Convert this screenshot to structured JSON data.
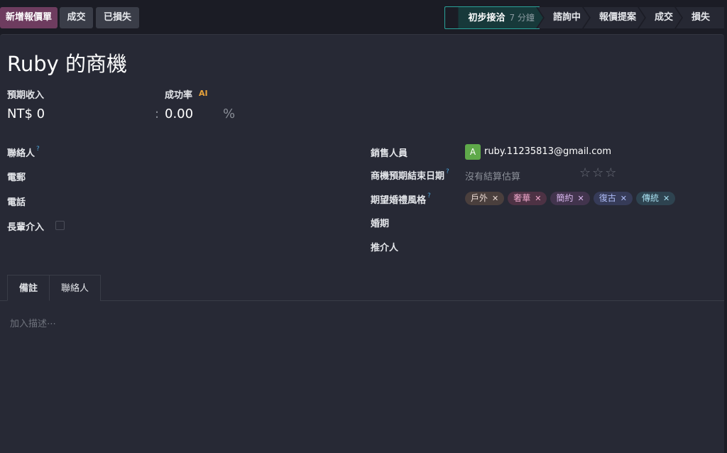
{
  "toolbar": {
    "new_quote": "新增報價單",
    "won": "成交",
    "lost": "已損失"
  },
  "stages": [
    {
      "label": "初步接洽",
      "duration": "7 分鐘"
    },
    {
      "label": "諮詢中"
    },
    {
      "label": "報價提案"
    },
    {
      "label": "成交"
    },
    {
      "label": "損失"
    }
  ],
  "record": {
    "title": "Ruby 的商機",
    "expected_revenue_label": "預期收入",
    "expected_revenue": "NT$ 0",
    "probability_label": "成功率",
    "probability_icon": "ai-icon",
    "colon": ":",
    "probability": "0.00",
    "percent": "%",
    "contact_label": "聯絡人",
    "help_mark": "?",
    "email_label": "電郵",
    "phone_label": "電話",
    "elder_label": "長輩介入",
    "salesperson_label": "銷售人員",
    "salesperson_initial": "A",
    "salesperson_email": "ruby.11235813@gmail.com",
    "deadline_label": "商機預期結束日期",
    "deadline_placeholder": "沒有結算估算",
    "style_label": "期望婚禮風格",
    "tags": [
      {
        "label": "戶外",
        "bg": "#4a3f3d",
        "fg": "#e8d8d2"
      },
      {
        "label": "奢華",
        "bg": "#4d3244",
        "fg": "#f0a8cc"
      },
      {
        "label": "簡約",
        "bg": "#42344d",
        "fg": "#d9b8ef"
      },
      {
        "label": "復古",
        "bg": "#363b58",
        "fg": "#aebcf7"
      },
      {
        "label": "傳統",
        "bg": "#2e4350",
        "fg": "#a8dff0"
      }
    ],
    "wedding_date_label": "婚期",
    "referrer_label": "推介人"
  },
  "tabs": [
    {
      "label": "備註"
    },
    {
      "label": "聯絡人"
    }
  ],
  "notes": {
    "placeholder": "加入描述⋯"
  },
  "colors": {
    "primary": "#6e3c5f",
    "active_stage": "#17393a",
    "avatar": "#5fa94a"
  }
}
